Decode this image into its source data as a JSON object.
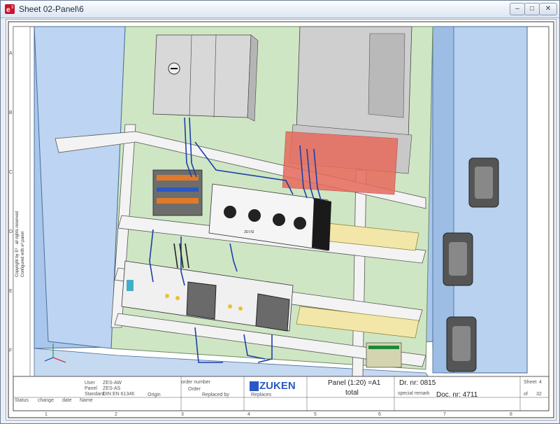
{
  "window": {
    "title": "Sheet 02-Panel\\6",
    "minimize_glyph": "–",
    "maximize_glyph": "□",
    "close_glyph": "✕"
  },
  "frame": {
    "columns": [
      "1",
      "2",
      "3",
      "4",
      "5",
      "6",
      "7",
      "8"
    ],
    "rows": [
      "A",
      "B",
      "C",
      "D",
      "E",
      "F"
    ]
  },
  "components": {
    "breaker_label": "ZEVSI"
  },
  "side_notes": {
    "line1": "Copyright by E³ · all rights reserved",
    "line2": "Configured with e³.panel"
  },
  "title_block": {
    "logo_text": "ZUKEN",
    "panel_label": "Panel (1:20) =A1",
    "total_label": "total",
    "drawing_nr": "Dr. nr: 0815",
    "doc_nr": "Doc. nr: 4711",
    "user_label": "User",
    "user_value": "ZES-AW",
    "panel_label_small": "Panel",
    "panel_value": "ZES-AS",
    "standard_label": "Standard",
    "standard_value": "DIN EN 61346",
    "status": "Status",
    "change": "change",
    "date": "date",
    "name": "Name",
    "origin": "Origin",
    "replaced_by": "Replaced by",
    "replaces": "Replaces",
    "order_number": "order number",
    "order": "Order",
    "special_remark": "special remark",
    "sheet": "Sheet",
    "sheet_value": "4",
    "of": "of",
    "of_value": "32"
  },
  "colors": {
    "panel_blue": "#a9c7ec",
    "mount_green": "#cfe6c4",
    "rail_white": "#f3f3f3",
    "wire_blue": "#1c3fa8",
    "highlight_red": "#e76a5c",
    "din_yellow": "#f2e7a8"
  }
}
